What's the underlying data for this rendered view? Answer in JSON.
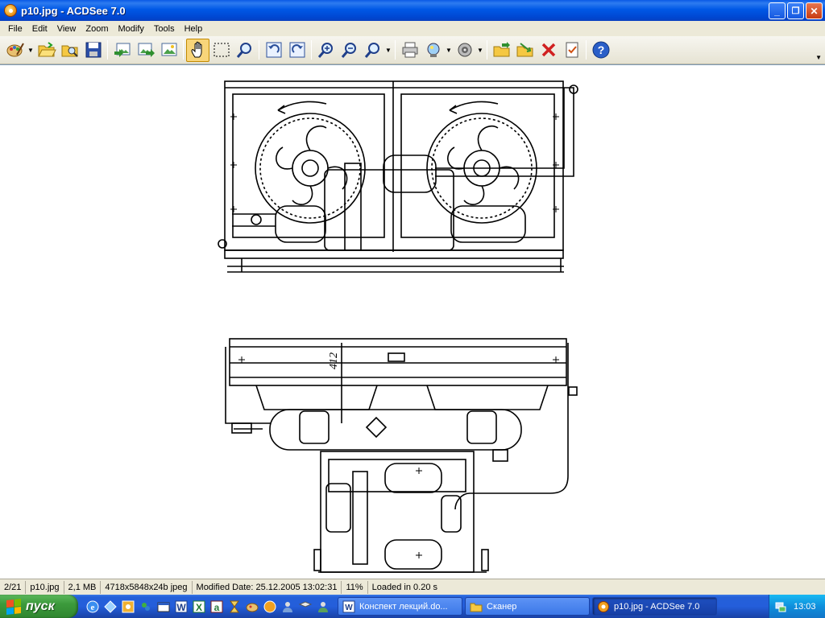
{
  "window": {
    "title": "p10.jpg - ACDSee 7.0",
    "minimize_glyph": "_",
    "restore_glyph": "❐",
    "close_glyph": "✕"
  },
  "menu": [
    {
      "label": "File"
    },
    {
      "label": "Edit"
    },
    {
      "label": "View"
    },
    {
      "label": "Zoom"
    },
    {
      "label": "Modify"
    },
    {
      "label": "Tools"
    },
    {
      "label": "Help"
    }
  ],
  "toolbar": {
    "icons": [
      "acquire-icon",
      "open-folder-icon",
      "browse-icon",
      "save-icon",
      "previous-image-icon",
      "next-image-icon",
      "auto-advance-icon",
      "hand-tool-icon",
      "selection-tool-icon",
      "zoom-tool-icon",
      "rotate-left-icon",
      "rotate-right-icon",
      "zoom-in-icon",
      "zoom-out-icon",
      "zoom-fit-icon",
      "print-icon",
      "wallpaper-icon",
      "slideshow-icon",
      "copy-to-folder-icon",
      "move-to-folder-icon",
      "delete-icon",
      "properties-icon",
      "help-icon"
    ],
    "active_tool": "hand-tool-icon"
  },
  "image": {
    "description_icon": "technical-drawing-image"
  },
  "status": {
    "position": "2/21",
    "filename": "p10.jpg",
    "filesize": "2,1 MB",
    "dimensions": "4718x5848x24b jpeg",
    "modified": "Modified Date: 25.12.2005 13:02:31",
    "zoom": "11%",
    "load_time": "Loaded in 0.20 s"
  },
  "taskbar": {
    "start_label": "пуск",
    "tasks": [
      {
        "label": "Конспект лекций.do...",
        "icon": "word-doc-icon",
        "active": false
      },
      {
        "label": "Сканер",
        "icon": "folder-icon",
        "active": false
      },
      {
        "label": "p10.jpg - ACDSee 7.0",
        "icon": "acdsee-icon",
        "active": true
      }
    ],
    "clock": "13:03"
  },
  "drawing": {
    "dimension_label": "412"
  }
}
